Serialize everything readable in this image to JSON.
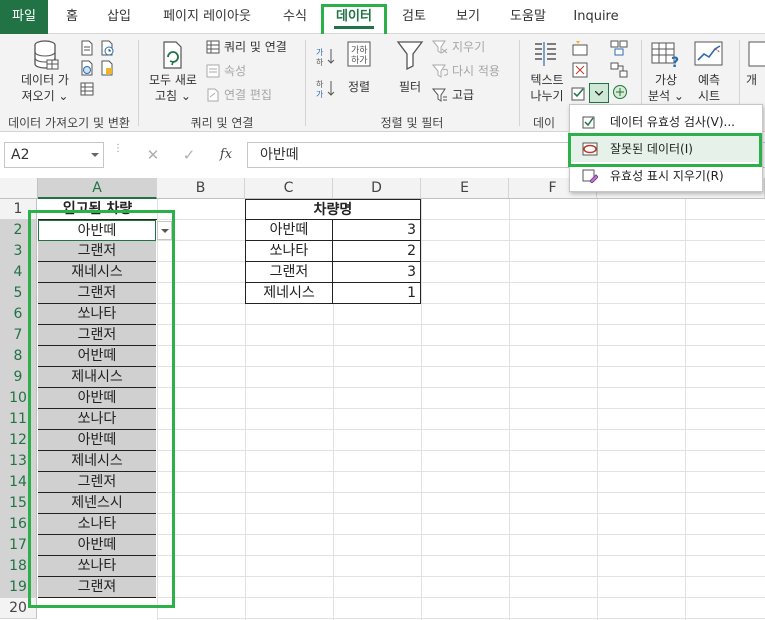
{
  "tabs": {
    "file": "파일",
    "home": "홈",
    "insert": "삽입",
    "layout": "페이지 레이아웃",
    "formulas": "수식",
    "data": "데이터",
    "review": "검토",
    "view": "보기",
    "help": "도움말",
    "inquire": "Inquire"
  },
  "ribbon": {
    "get_data_line1": "데이터 가",
    "get_data_line2": "져오기 ⌄",
    "refresh_line1": "모두 새로",
    "refresh_line2": "고침 ⌄",
    "queries": "쿼리 및 연결",
    "properties": "속성",
    "edit_links": "연결 편집",
    "sort": "정렬",
    "filter": "필터",
    "clear": "지우기",
    "reapply": "다시 적용",
    "advanced": "고급",
    "text_to_columns_line1": "텍스트",
    "text_to_columns_line2": "나누기",
    "whatif_line1": "가상",
    "whatif_line2": "분석 ⌄",
    "forecast_line1": "예측",
    "forecast_line2": "시트",
    "outline_partial": "개",
    "groups": {
      "get_transform": "데이터 가져오기 및 변환",
      "queries": "쿼리 및 연결",
      "sort_filter": "정렬 및 필터",
      "data_tools_partial": "데이"
    }
  },
  "dropdown_menu": {
    "items": [
      "데이터 유효성 검사(V)...",
      "잘못된 데이터(I)",
      "유효성 표시 지우기(R)"
    ]
  },
  "formula_bar": {
    "name_box": "A2",
    "cancel": "✕",
    "enter": "✓",
    "fx": "fx",
    "value": "아반떼"
  },
  "columns": [
    "A",
    "B",
    "C",
    "D",
    "E",
    "F"
  ],
  "rows": [
    "1",
    "2",
    "3",
    "4",
    "5",
    "6",
    "7",
    "8",
    "9",
    "10",
    "11",
    "12",
    "13",
    "14",
    "15",
    "16",
    "17",
    "18",
    "19",
    "20"
  ],
  "column_a": {
    "header": "입고된 차량",
    "values": [
      "아반떼",
      "그랜저",
      "재네시스",
      "그랜저",
      "쏘나타",
      "그랜저",
      "어반떼",
      "제내시스",
      "아반떼",
      "쏘나다",
      "아반떼",
      "제네시스",
      "그렌저",
      "제넨스시",
      "소나타",
      "아반떼",
      "쏘나타",
      "그랜져"
    ]
  },
  "summary_table": {
    "header": "차량명",
    "rows": [
      {
        "name": "아반떼",
        "count": "3"
      },
      {
        "name": "쏘나타",
        "count": "2"
      },
      {
        "name": "그랜저",
        "count": "3"
      },
      {
        "name": "제네시스",
        "count": "1"
      }
    ]
  },
  "colors": {
    "excel_green": "#217346",
    "highlight_green": "#2cb04a",
    "selection_gray": "#d0d0d0"
  }
}
